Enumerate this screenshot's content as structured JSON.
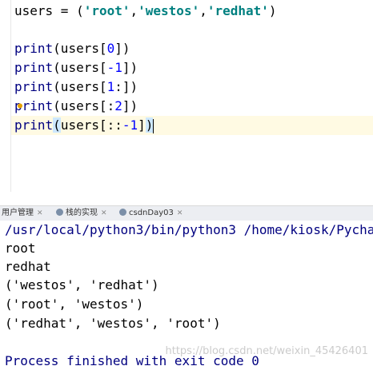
{
  "editor": {
    "lines": [
      {
        "prefix": "users = (",
        "s1": "'root'",
        "c1": ",",
        "s2": "'westos'",
        "c2": ",",
        "s3": "'redhat'",
        "suffix": ")"
      },
      {
        "fn": "print",
        "open": "(users[",
        "num": "0",
        "close": "])"
      },
      {
        "fn": "print",
        "open": "(users[",
        "num": "-1",
        "close": "])"
      },
      {
        "fn": "print",
        "open": "(users[",
        "num": "1",
        "close": ":])"
      },
      {
        "fn": "print",
        "open": "(users[:",
        "num": "2",
        "close": "])"
      },
      {
        "fn": "print",
        "paren_open": "(",
        "mid": "users[::",
        "num": "-1",
        "mid2": "]",
        "paren_close": ")"
      }
    ]
  },
  "run_tabs": [
    {
      "label": "用户管理"
    },
    {
      "label": "栈的实现"
    },
    {
      "label": "csdnDay03"
    }
  ],
  "console": {
    "command": "/usr/local/python3/bin/python3 /home/kiosk/Pychar",
    "output": [
      "root",
      "redhat",
      "('westos', 'redhat')",
      "('root', 'westos')",
      "('redhat', 'westos', 'root')"
    ],
    "exit_message": "Process finished with exit code 0",
    "watermark": "https://blog.csdn.net/weixin_45426401"
  },
  "colors": {
    "keyword": "#000080",
    "string": "#008080",
    "number": "#0000ff",
    "current_line": "#fffae3"
  }
}
